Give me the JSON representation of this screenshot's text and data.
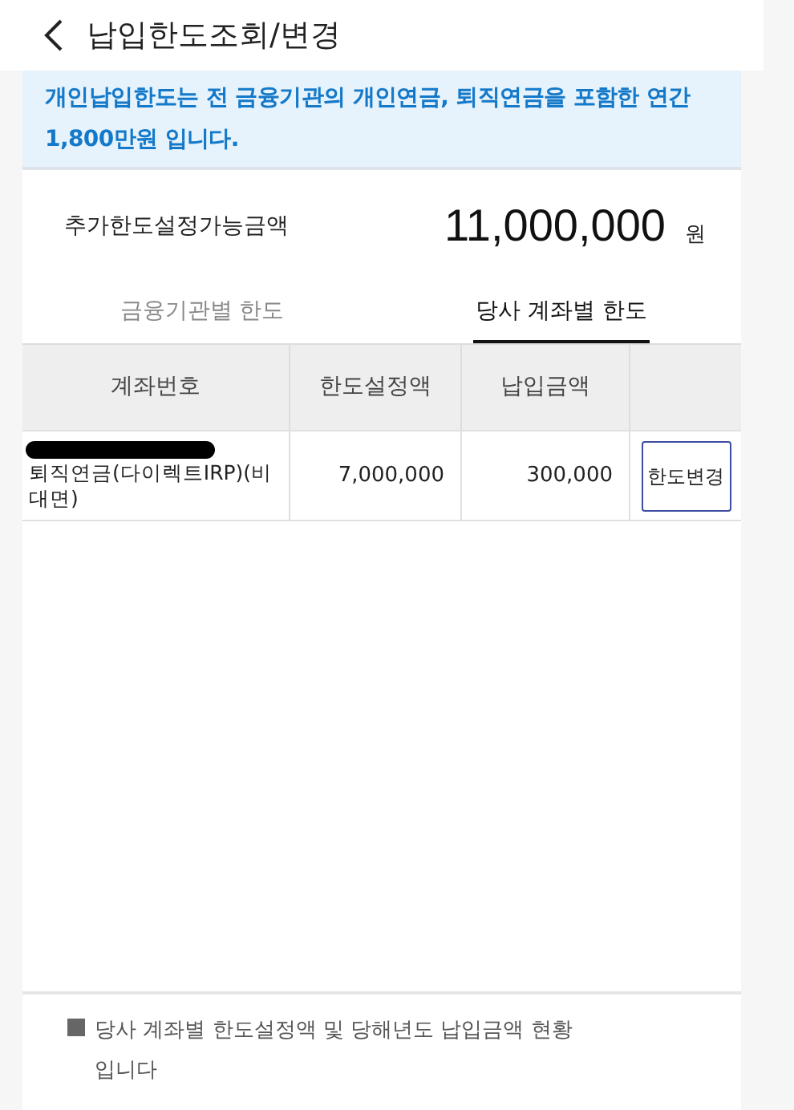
{
  "header": {
    "title": "납입한도조회/변경"
  },
  "notice": "개인납입한도는 전 금융기관의 개인연금, 퇴직연금을 포함한 연간 1,800만원 입니다.",
  "available": {
    "label": "추가한도설정가능금액",
    "amount": "11,000,000",
    "unit": "원"
  },
  "tabs": [
    {
      "label": "금융기관별 한도",
      "selected": false
    },
    {
      "label": "당사 계좌별 한도",
      "selected": true
    }
  ],
  "table": {
    "columns": [
      "계좌번호",
      "한도설정액",
      "납입금액"
    ],
    "rows": [
      {
        "account_redacted": true,
        "account_name": "퇴직연금(다이렉트IRP)(비대면)",
        "limit": "7,000,000",
        "paid": "300,000",
        "action": "한도변경"
      }
    ]
  },
  "footnote": "당사 계좌별 한도설정액 및 당해년도 납입금액 현황입니다"
}
